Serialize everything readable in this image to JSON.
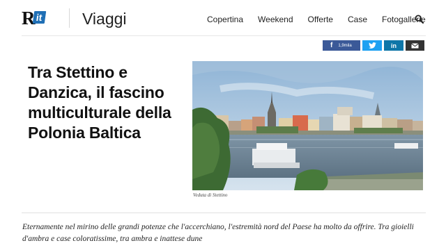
{
  "brand": {
    "logo_text": "R",
    "logo_suffix": "it"
  },
  "header": {
    "section_title": "Viaggi"
  },
  "nav": {
    "items": [
      "Copertina",
      "Weekend",
      "Offerte",
      "Case",
      "Fotogallerie"
    ]
  },
  "share": {
    "facebook_label": "f",
    "facebook_count": "1,9mila",
    "linkedin_label": "in"
  },
  "article": {
    "headline": "Tra Stettino e Danzica, il fascino multiculturale della Polonia Baltica",
    "photo_caption": "Veduta di Stettino",
    "summary": "Eternamente nel mirino delle grandi potenze che l'accerchiano, l'estremità nord del Paese ha molto da offrire. Tra gioielli d'ambra e case coloratissime, tra ambra e inattese dune"
  },
  "colors": {
    "facebook": "#3b5998",
    "twitter": "#1da1f2",
    "linkedin": "#0e76a8",
    "mail": "#333333",
    "logo_accent": "#1f6fb5"
  }
}
